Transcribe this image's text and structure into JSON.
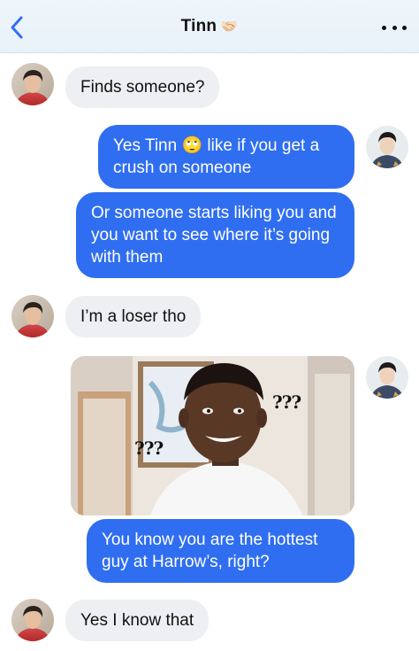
{
  "header": {
    "title": "Tinn",
    "title_emoji": "🤝🏻",
    "back_icon": "chevron-left-icon",
    "more_icon": "more-dots-icon",
    "accent": "#2f6ef0"
  },
  "messages": [
    {
      "side": "in",
      "text": "Finds someone?"
    },
    {
      "side": "out",
      "text_parts": [
        "Yes Tinn ",
        "🙄",
        " like if you get a crush on someone"
      ]
    },
    {
      "side": "out",
      "text": "Or someone starts liking you and you want to see where it’s going with them"
    },
    {
      "side": "in",
      "text": "I’m a loser tho"
    },
    {
      "side": "out",
      "type": "image",
      "image_text": [
        "???",
        "???"
      ]
    },
    {
      "side": "out",
      "text": "You know you are the hottest guy at Harrow’s, right?"
    },
    {
      "side": "in",
      "text": "Yes I know that"
    }
  ],
  "colors": {
    "incoming_bubble": "#eeeff2",
    "outgoing_bubble": "#2f6ef0"
  }
}
